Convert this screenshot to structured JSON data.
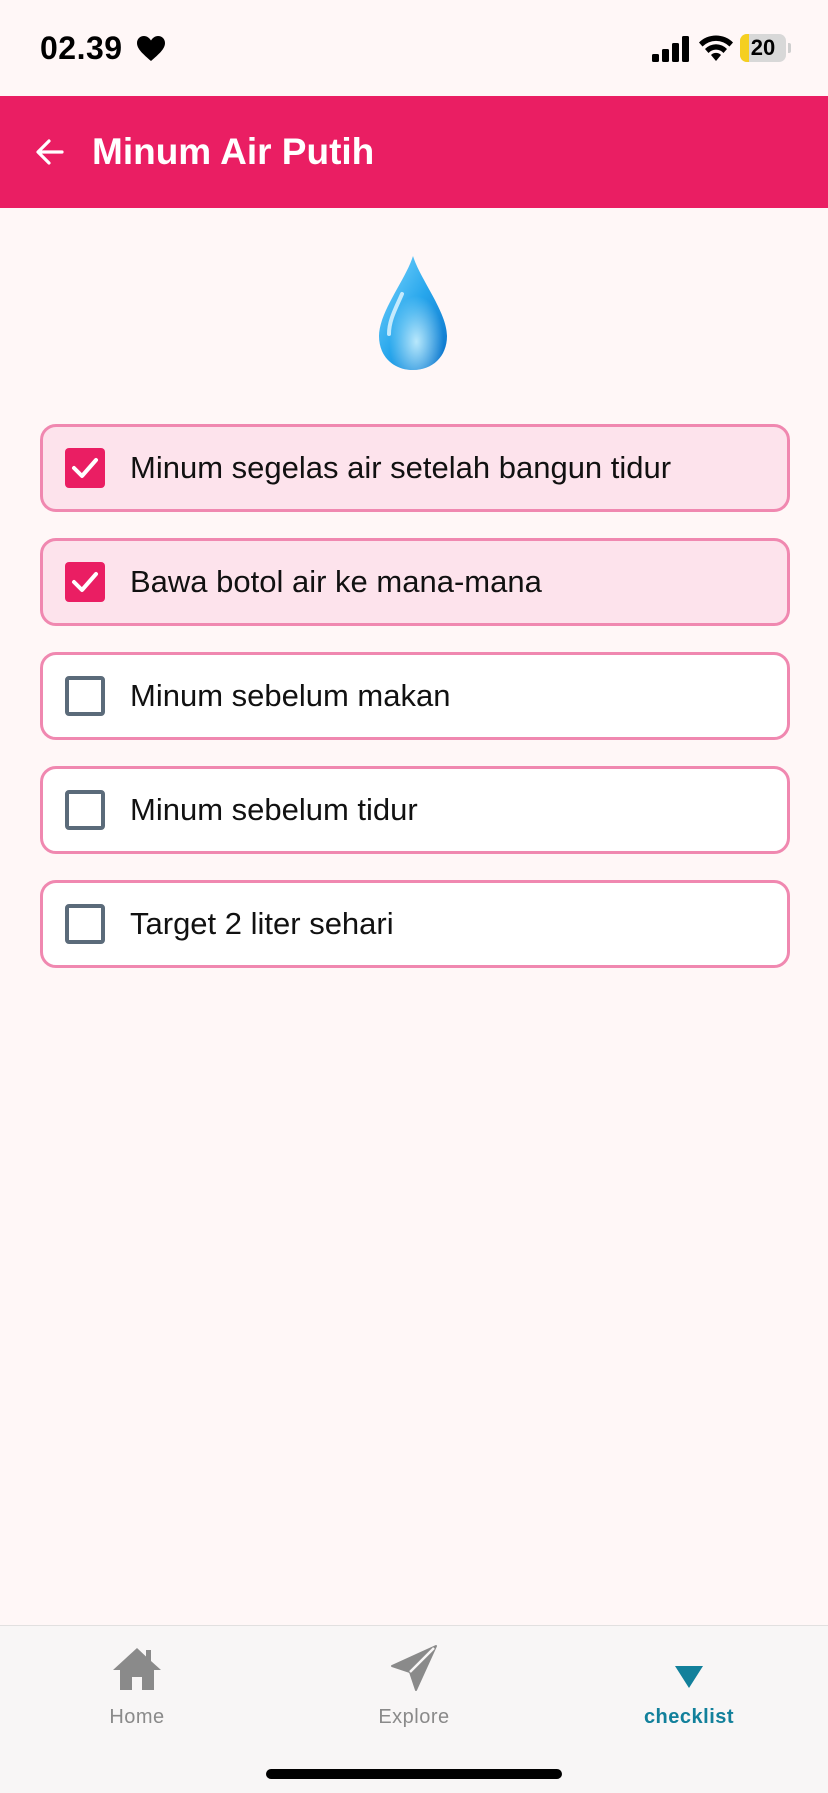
{
  "status_bar": {
    "time": "02.39",
    "battery_level": "20",
    "battery_fraction": 0.2
  },
  "app_bar": {
    "title": "Minum Air Putih",
    "back_icon": "arrow-left-icon"
  },
  "hero": {
    "icon": "water-drop-icon"
  },
  "checklist": {
    "items": [
      {
        "label": "Minum segelas air setelah bangun tidur",
        "checked": true
      },
      {
        "label": "Bawa botol air ke mana-mana",
        "checked": true
      },
      {
        "label": "Minum sebelum makan",
        "checked": false
      },
      {
        "label": "Minum sebelum tidur",
        "checked": false
      },
      {
        "label": "Target 2 liter sehari",
        "checked": false
      }
    ]
  },
  "bottom_nav": {
    "items": [
      {
        "label": "Home",
        "icon": "home-icon",
        "active": false
      },
      {
        "label": "Explore",
        "icon": "send-icon",
        "active": false
      },
      {
        "label": "checklist",
        "icon": "triangle-down-icon",
        "active": true
      }
    ]
  },
  "colors": {
    "accent": "#ea1e63",
    "accent_light": "#fde3ec",
    "border": "#f088b0",
    "background": "#fff7f7",
    "active_nav": "#12809b",
    "inactive_nav": "#8a8a8a"
  }
}
